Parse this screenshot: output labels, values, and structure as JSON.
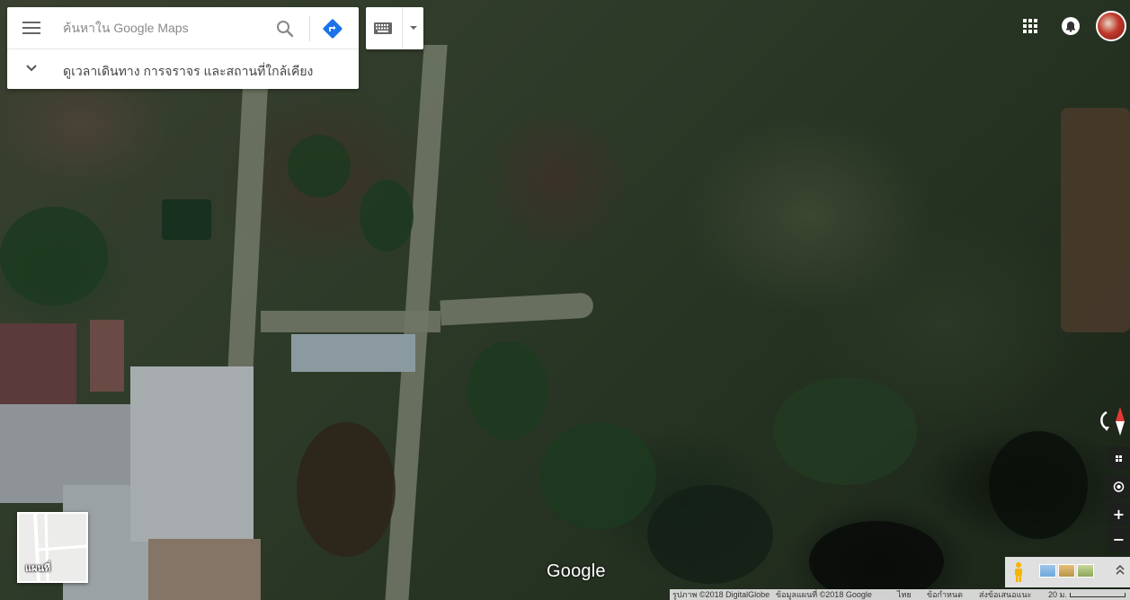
{
  "search": {
    "placeholder": "ค้นหาใน Google Maps",
    "nearby_text": "ดูเวลาเดินทาง การจราจร และสถานที่ใกล้เคียง"
  },
  "icons": {
    "menu": "hamburger-menu-icon",
    "search": "magnifier-icon",
    "directions": "directions-arrow-icon",
    "keyboard": "keyboard-icon",
    "apps": "apps-grid-icon",
    "notifications": "bell-icon",
    "compass": "compass-icon",
    "pegman": "pegman-icon"
  },
  "colors": {
    "directions_blue": "#1a73e8",
    "compass_red": "#e53935"
  },
  "minimap": {
    "label": "แผนที่"
  },
  "map_controls": {
    "zoom_in": "+",
    "zoom_out": "−"
  },
  "logo": "Google",
  "footer": {
    "imagery": "รูปภาพ ©2018 DigitalGlobe",
    "map_data": "ข้อมูลแผนที่ ©2018 Google",
    "language": "ไทย",
    "terms": "ข้อกำหนด",
    "feedback": "ส่งข้อเสนอแนะ",
    "scale": "20 ม."
  }
}
